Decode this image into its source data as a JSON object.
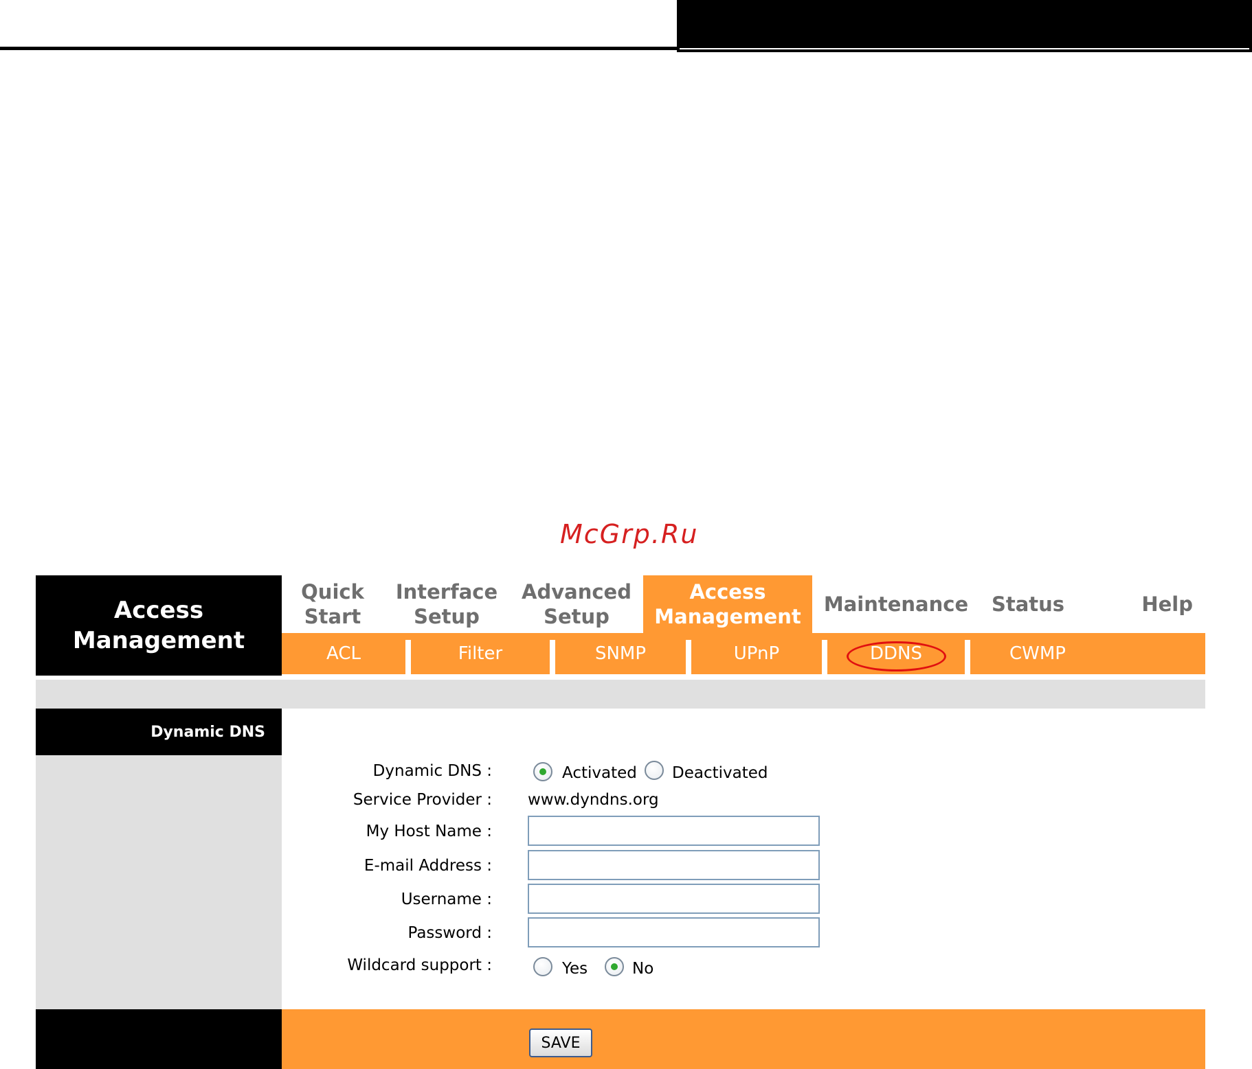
{
  "watermark": "McGrp.Ru",
  "brand": {
    "title": "Access\nManagement"
  },
  "main_nav": [
    {
      "label": "Quick\nStart",
      "active": false
    },
    {
      "label": "Interface\nSetup",
      "active": false
    },
    {
      "label": "Advanced\nSetup",
      "active": false
    },
    {
      "label": "Access\nManagement",
      "active": true
    },
    {
      "label": "Maintenance",
      "active": false
    },
    {
      "label": "Status",
      "active": false
    },
    {
      "label": "Help",
      "active": false
    }
  ],
  "sub_nav": [
    {
      "label": "ACL"
    },
    {
      "label": "Filter"
    },
    {
      "label": "SNMP"
    },
    {
      "label": "UPnP"
    },
    {
      "label": "DDNS",
      "highlighted": true
    },
    {
      "label": "CWMP"
    }
  ],
  "section": {
    "title": "Dynamic DNS"
  },
  "form": {
    "dynamic_dns": {
      "label": "Dynamic DNS :",
      "options": [
        "Activated",
        "Deactivated"
      ],
      "selected": "Activated"
    },
    "service_provider": {
      "label": "Service Provider :",
      "value": "www.dyndns.org"
    },
    "host_name": {
      "label": "My Host Name :",
      "value": ""
    },
    "email": {
      "label": "E-mail Address :",
      "value": ""
    },
    "username": {
      "label": "Username :",
      "value": ""
    },
    "password": {
      "label": "Password :",
      "value": ""
    },
    "wildcard": {
      "label": "Wildcard support :",
      "options": [
        "Yes",
        "No"
      ],
      "selected": "No"
    }
  },
  "buttons": {
    "save": "SAVE"
  },
  "colors": {
    "accent": "#ff9933",
    "black": "#000000",
    "gray": "#e0e0e0",
    "tab_text": "#6e6e6e",
    "highlight": "#e01010",
    "watermark": "#d62020"
  }
}
